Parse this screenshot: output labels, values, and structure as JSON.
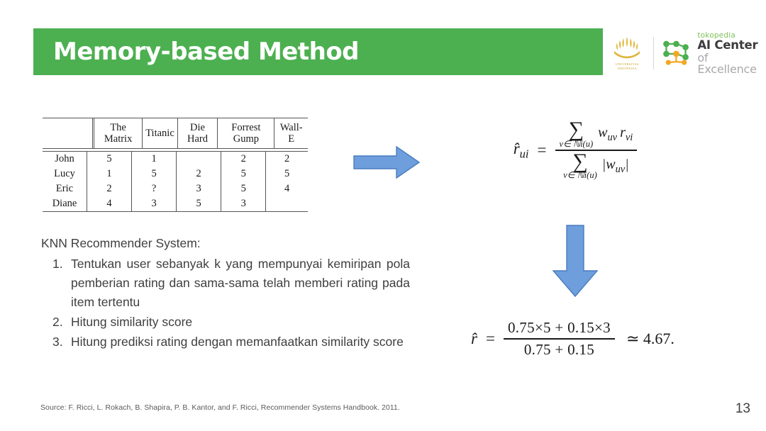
{
  "slide": {
    "title": "Memory-based Method",
    "banner_color": "#4CB050",
    "page_number": "13",
    "source_note": "Source: F. Ricci, L. Rokach, B. Shapira, P. B. Kantor, and F. Ricci, Recommender Systems Handbook. 2011."
  },
  "logos": {
    "university": {
      "name": "universitas-indonesia-logo",
      "caption_line1": "UNIVERSITAS",
      "caption_line2": "INDONESIA",
      "color": "#E0B73E"
    },
    "tokopedia": {
      "brand": "tokopedia",
      "line1": "AI Center",
      "line2": "of Excellence",
      "brand_color": "#7FC45B",
      "node_green": "#4CAF50",
      "node_orange": "#F5A623"
    }
  },
  "ratings_table": {
    "corner_label": "",
    "columns": [
      "The Matrix",
      "Titanic",
      "Die Hard",
      "Forrest Gump",
      "Wall-E"
    ],
    "rows": [
      {
        "user": "John",
        "ratings": [
          "5",
          "1",
          "",
          "2",
          "2"
        ]
      },
      {
        "user": "Lucy",
        "ratings": [
          "1",
          "5",
          "2",
          "5",
          "5"
        ]
      },
      {
        "user": "Eric",
        "ratings": [
          "2",
          "?",
          "3",
          "5",
          "4"
        ]
      },
      {
        "user": "Diane",
        "ratings": [
          "4",
          "3",
          "5",
          "3",
          ""
        ]
      }
    ]
  },
  "arrows": {
    "right": {
      "name": "right-arrow",
      "color": "#6699DD"
    },
    "down": {
      "name": "down-arrow",
      "color": "#6699DD"
    }
  },
  "formula_main": {
    "lhs": "r̂",
    "lhs_sub": "ui",
    "equals": "=",
    "numerator_sum_sub": "v∈ ℕi(u)",
    "numerator_term": "w",
    "numerator_term_sub": "uv",
    "numerator_term2": "r",
    "numerator_term2_sub": "vi",
    "denominator_sum_sub": "v∈ ℕi(u)",
    "denominator_term": "|w",
    "denominator_term_sub": "uv",
    "denominator_term_close": "|"
  },
  "formula_result": {
    "lhs": "r̂",
    "equals": "=",
    "numerator": "0.75×5 + 0.15×3",
    "denominator": "0.75 + 0.15",
    "approx": "≃ 4.67."
  },
  "knn": {
    "heading": "KNN Recommender System:",
    "items": [
      {
        "number": "1.",
        "text": "Tentukan user sebanyak k yang mempunyai kemiripan pola pemberian rating dan sama-sama telah memberi rating pada item tertentu"
      },
      {
        "number": "2.",
        "text": "Hitung similarity score"
      },
      {
        "number": "3.",
        "text": "Hitung prediksi rating dengan memanfaatkan similarity score"
      }
    ]
  }
}
